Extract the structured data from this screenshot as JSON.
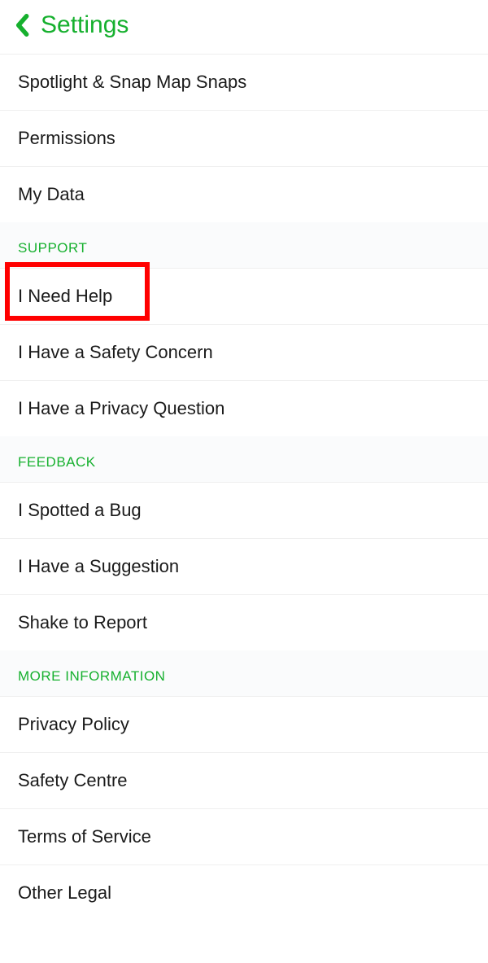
{
  "header": {
    "title": "Settings"
  },
  "top_items": [
    {
      "label": "Spotlight & Snap Map Snaps"
    },
    {
      "label": "Permissions"
    },
    {
      "label": "My Data"
    }
  ],
  "sections": [
    {
      "title": "Support",
      "items": [
        {
          "label": "I Need Help",
          "highlighted": true
        },
        {
          "label": "I Have a Safety Concern"
        },
        {
          "label": "I Have a Privacy Question"
        }
      ]
    },
    {
      "title": "Feedback",
      "items": [
        {
          "label": "I Spotted a Bug"
        },
        {
          "label": "I Have a Suggestion"
        },
        {
          "label": "Shake to Report"
        }
      ]
    },
    {
      "title": "More Information",
      "items": [
        {
          "label": "Privacy Policy"
        },
        {
          "label": "Safety Centre"
        },
        {
          "label": "Terms of Service"
        },
        {
          "label": "Other Legal"
        }
      ]
    }
  ]
}
